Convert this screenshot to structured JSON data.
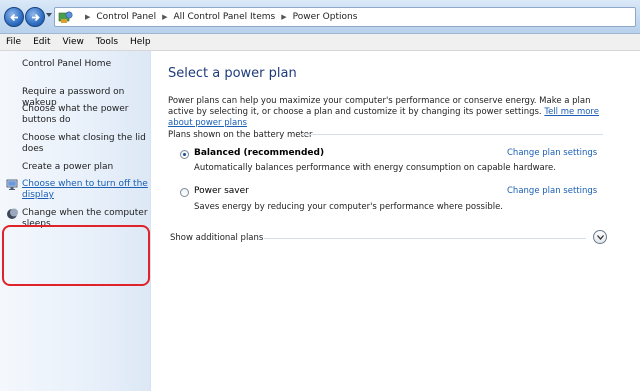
{
  "address_bar": {
    "breadcrumbs": [
      "Control Panel",
      "All Control Panel Items",
      "Power Options"
    ]
  },
  "menu": {
    "items": [
      "File",
      "Edit",
      "View",
      "Tools",
      "Help"
    ]
  },
  "sidebar": {
    "home": "Control Panel Home",
    "links": [
      {
        "label": "Require a password on wakeup"
      },
      {
        "label": "Choose what the power buttons do"
      },
      {
        "label": "Choose what closing the lid does"
      },
      {
        "label": "Create a power plan"
      },
      {
        "label": "Choose when to turn off the display",
        "icon": "display-icon"
      },
      {
        "label": "Change when the computer sleeps",
        "icon": "moon-icon"
      }
    ]
  },
  "main": {
    "title": "Select a power plan",
    "description": "Power plans can help you maximize your computer's performance or conserve energy. Make a plan active by selecting it, or choose a plan and customize it by changing its power settings.",
    "learn_more": "Tell me more about power plans",
    "section_header": "Plans shown on the battery meter",
    "plans": [
      {
        "name": "Balanced (recommended)",
        "description": "Automatically balances performance with energy consumption on capable hardware.",
        "link": "Change plan settings",
        "selected": true
      },
      {
        "name": "Power saver",
        "description": "Saves energy by reducing your computer's performance where possible.",
        "link": "Change plan settings",
        "selected": false
      }
    ],
    "show_additional": "Show additional plans"
  },
  "colors": {
    "link": "#1a5fb4",
    "title": "#1f3b7a",
    "highlight": "#e0232a"
  }
}
